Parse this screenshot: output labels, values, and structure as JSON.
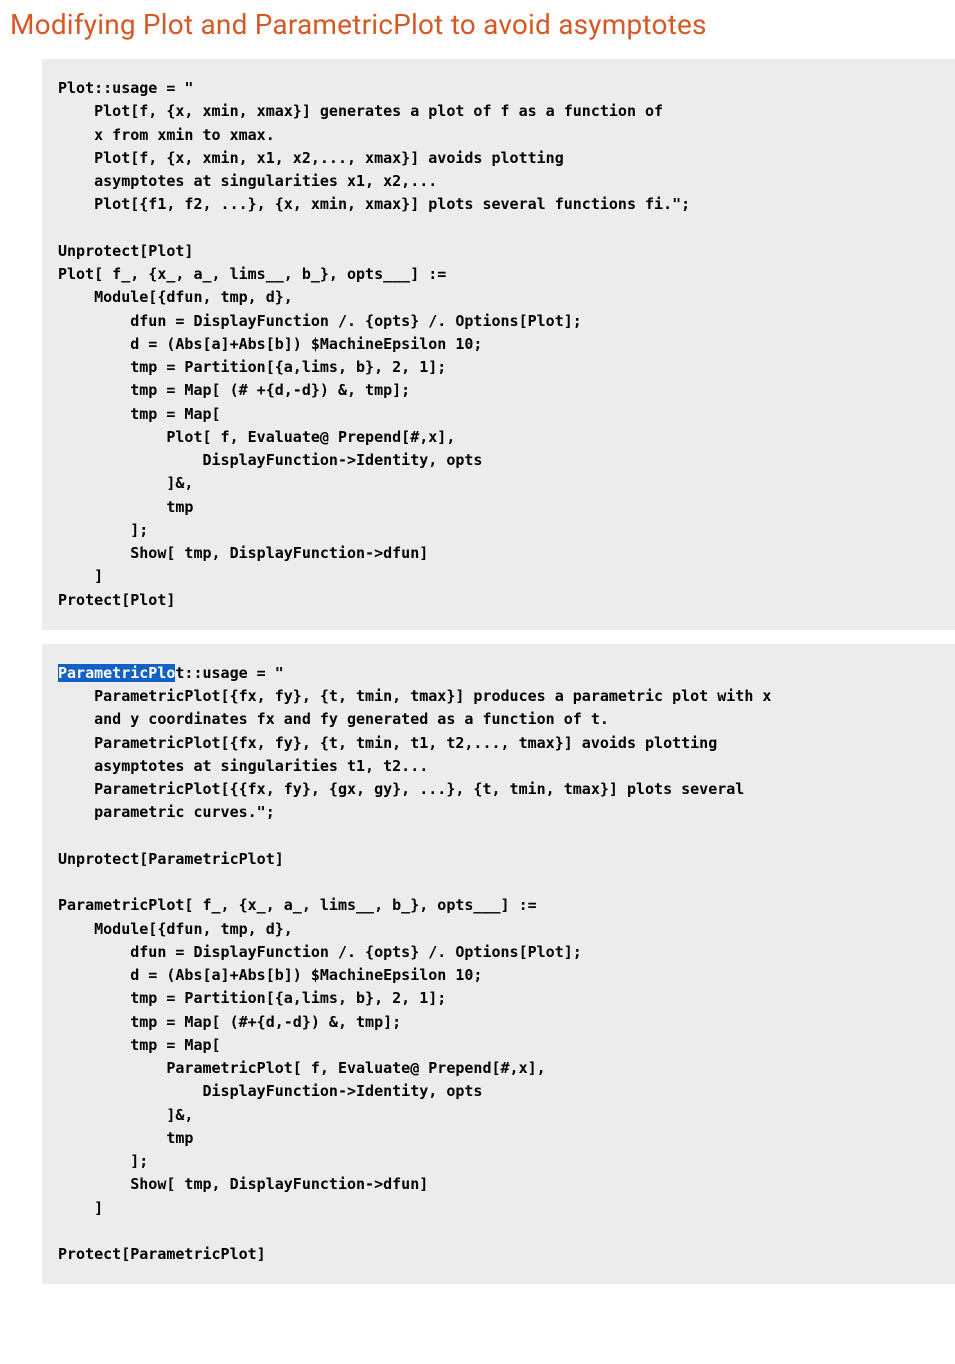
{
  "title": "Modifying Plot and ParametricPlot to avoid asymptotes",
  "block1": {
    "text": "Plot::usage = \"\n    Plot[f, {x, xmin, xmax}] generates a plot of f as a function of\n    x from xmin to xmax.\n    Plot[f, {x, xmin, x1, x2,..., xmax}] avoids plotting\n    asymptotes at singularities x1, x2,...\n    Plot[{f1, f2, ...}, {x, xmin, xmax}] plots several functions fi.\";\n\nUnprotect[Plot]\nPlot[ f_, {x_, a_, lims__, b_}, opts___] :=\n    Module[{dfun, tmp, d},\n        dfun = DisplayFunction /. {opts} /. Options[Plot];\n        d = (Abs[a]+Abs[b]) $MachineEpsilon 10;\n        tmp = Partition[{a,lims, b}, 2, 1];\n        tmp = Map[ (# +{d,-d}) &, tmp];\n        tmp = Map[\n            Plot[ f, Evaluate@ Prepend[#,x],\n                DisplayFunction->Identity, opts\n            ]&,\n            tmp\n        ];\n        Show[ tmp, DisplayFunction->dfun]\n    ]\nProtect[Plot]"
  },
  "block2": {
    "highlighted": "ParametricPlo",
    "after_highlight": "t::usage = \"\n    ParametricPlot[{fx, fy}, {t, tmin, tmax}] produces a parametric plot with x\n    and y coordinates fx and fy generated as a function of t.\n    ParametricPlot[{fx, fy}, {t, tmin, t1, t2,..., tmax}] avoids plotting\n    asymptotes at singularities t1, t2...\n    ParametricPlot[{{fx, fy}, {gx, gy}, ...}, {t, tmin, tmax}] plots several\n    parametric curves.\";\n\nUnprotect[ParametricPlot]\n\nParametricPlot[ f_, {x_, a_, lims__, b_}, opts___] :=\n    Module[{dfun, tmp, d},\n        dfun = DisplayFunction /. {opts} /. Options[Plot];\n        d = (Abs[a]+Abs[b]) $MachineEpsilon 10;\n        tmp = Partition[{a,lims, b}, 2, 1];\n        tmp = Map[ (#+{d,-d}) &, tmp];\n        tmp = Map[\n            ParametricPlot[ f, Evaluate@ Prepend[#,x],\n                DisplayFunction->Identity, opts\n            ]&,\n            tmp\n        ];\n        Show[ tmp, DisplayFunction->dfun]\n    ]\n\nProtect[ParametricPlot]"
  }
}
